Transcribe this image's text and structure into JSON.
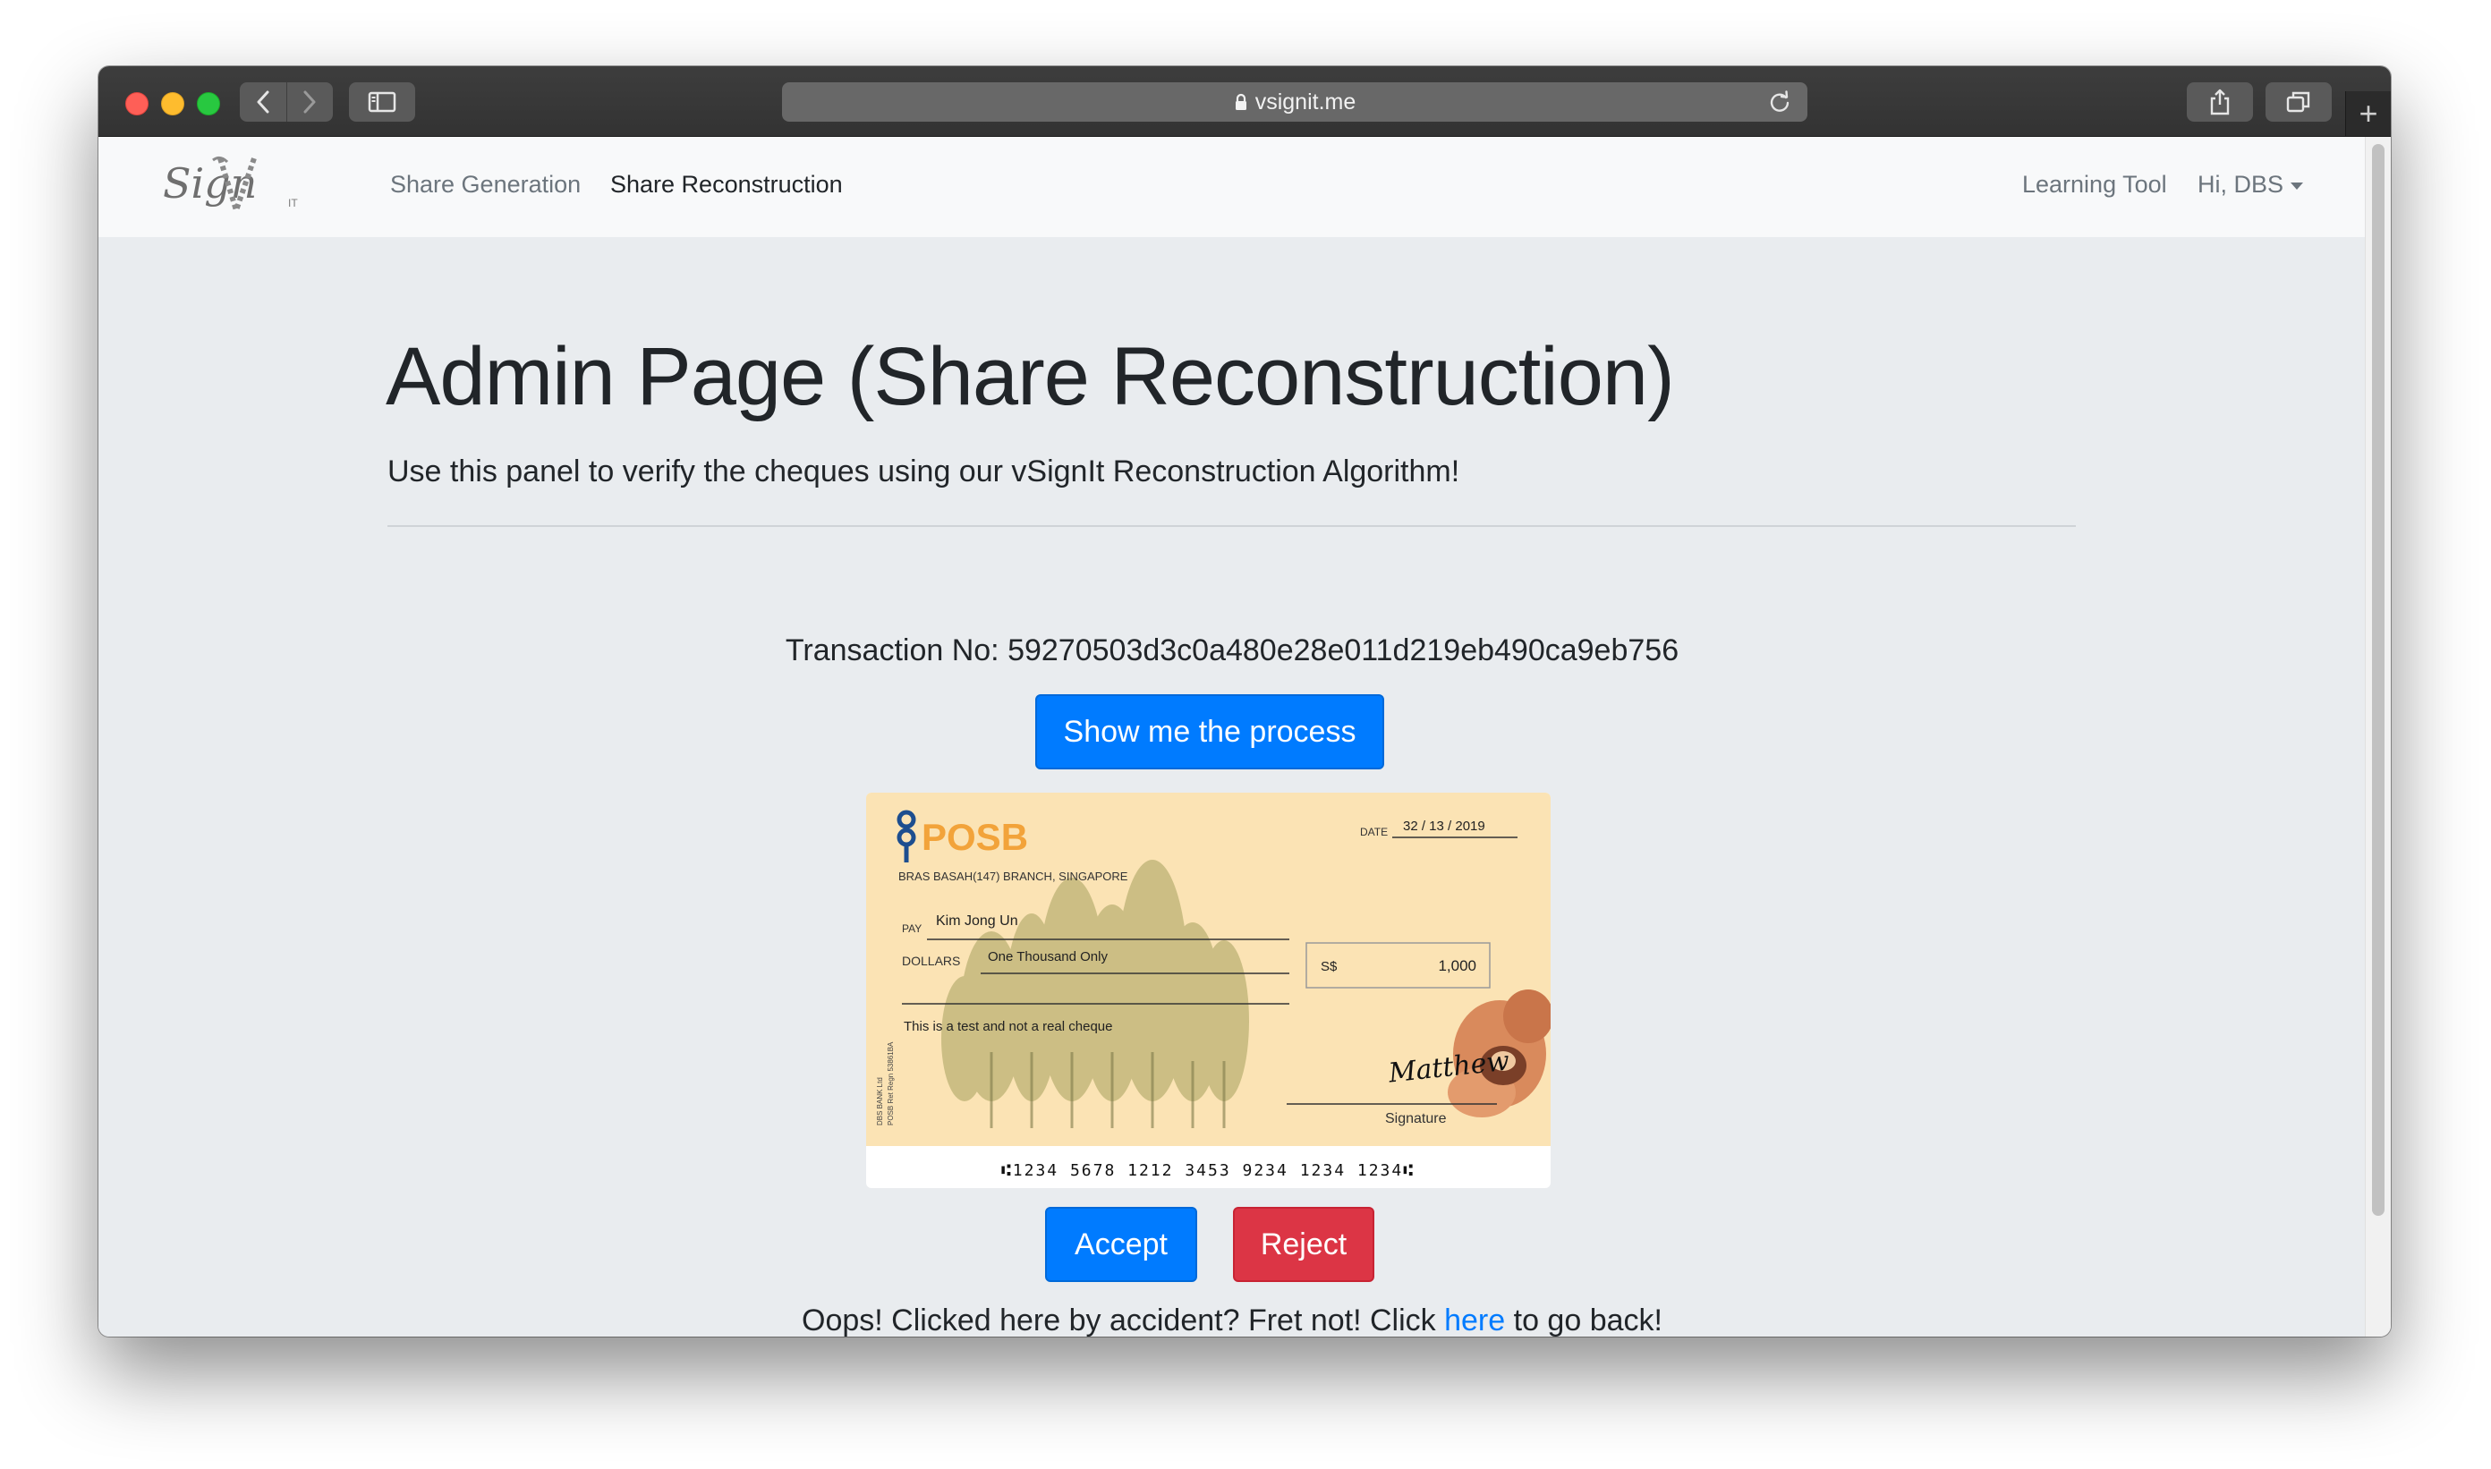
{
  "browser": {
    "url": "vsignit.me",
    "icons": {
      "back": "chevron-left-icon",
      "forward": "chevron-right-icon",
      "sidebar": "sidebar-icon",
      "lock": "lock-icon",
      "reload": "reload-icon",
      "share": "share-icon",
      "tabs": "tabs-icon",
      "new_tab": "plus-icon"
    },
    "new_tab_glyph": "+"
  },
  "navbar": {
    "brand_text": "Sign",
    "brand_suffix": "IT",
    "links": [
      {
        "label": "Share Generation",
        "active": false
      },
      {
        "label": "Share Reconstruction",
        "active": true
      }
    ],
    "right_links": [
      {
        "label": "Learning Tool"
      },
      {
        "label": "Hi, DBS",
        "dropdown": true
      }
    ]
  },
  "main": {
    "title": "Admin Page (Share Reconstruction)",
    "lead": "Use this panel to verify the cheques using our vSignIt Reconstruction Algorithm!",
    "transaction_label": "Transaction No:",
    "transaction_id": "59270503d3c0a480e28e011d219eb490ca9eb756",
    "process_button": "Show me the process",
    "accept_button": "Accept",
    "reject_button": "Reject",
    "footer_prefix": "Oops! Clicked here by accident? Fret not! Click",
    "footer_link": "here",
    "footer_suffix": "to go back!"
  },
  "cheque": {
    "bank": "POSB",
    "branch": "BRAS BASAH(147) BRANCH, SINGAPORE",
    "date_label": "DATE",
    "date": "32 / 13 / 2019",
    "pay_label": "PAY",
    "payee": "Kim Jong Un",
    "dollars_label": "DOLLARS",
    "amount_words": "One Thousand Only",
    "currency": "S$",
    "amount": "1,000",
    "note": "This is a test and not a real cheque",
    "side_text_1": "DBS BANK Ltd",
    "side_text_2": "POSB Ret Regn 53861BA",
    "signature_label": "Signature",
    "signature": "Matthew",
    "micr": "⑆1234 5678 1212 3453 9234 1234 1234⑆"
  },
  "colors": {
    "primary": "#007bff",
    "danger": "#dc3545",
    "page_bg": "#e9ecef",
    "navbar_bg": "#f8f9fa",
    "cheque_bg": "#fbe3b4",
    "posb_orange": "#f2a33a",
    "posb_blue": "#1d4e8f"
  }
}
